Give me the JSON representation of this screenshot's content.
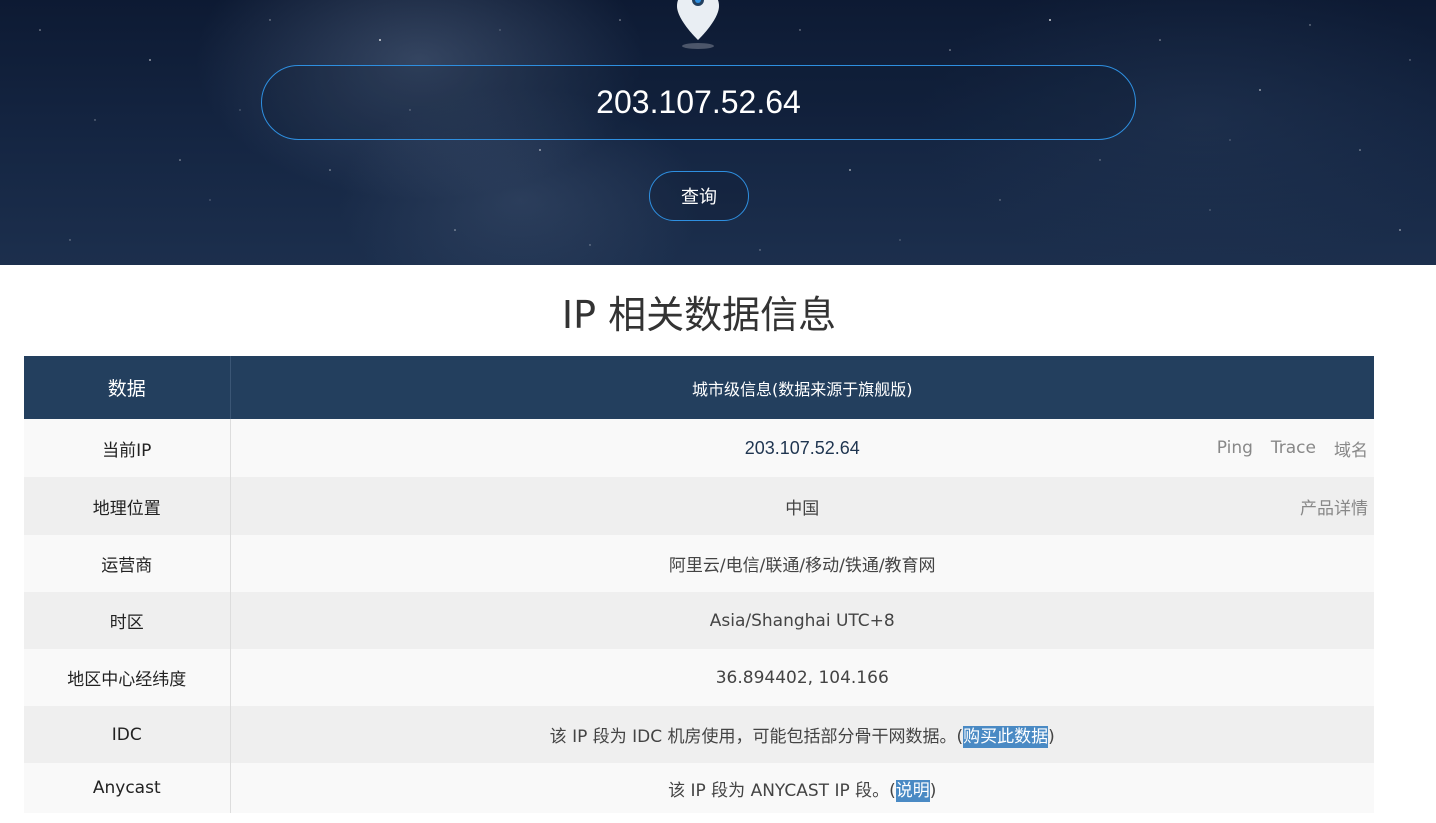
{
  "search": {
    "ip_value": "203.107.52.64",
    "button_label": "查询"
  },
  "section_title": "IP 相关数据信息",
  "table": {
    "headers": [
      "数据",
      "城市级信息(数据来源于旗舰版)"
    ],
    "rows": [
      {
        "label": "当前IP",
        "value": "203.107.52.64",
        "links": [
          "Ping",
          "Trace",
          "域名"
        ]
      },
      {
        "label": "地理位置",
        "value": "中国",
        "links": [
          "产品详情"
        ]
      },
      {
        "label": "运营商",
        "value": "阿里云/电信/联通/移动/铁通/教育网"
      },
      {
        "label": "时区",
        "value": "Asia/Shanghai UTC+8"
      },
      {
        "label": "地区中心经纬度",
        "value": "36.894402, 104.166"
      },
      {
        "label": "IDC",
        "text_before": "该 IP 段为 IDC 机房使用，可能包括部分骨干网数据。(",
        "link": "购买此数据",
        "text_after": ")"
      },
      {
        "label": "Anycast",
        "text_before": "该 IP 段为 ANYCAST IP 段。(",
        "link": "说明",
        "text_after": ")"
      }
    ]
  },
  "colors": {
    "header_bg": "#233f5e",
    "accent_border": "#2e8fe0",
    "link_highlight": "#4a8ac4"
  }
}
